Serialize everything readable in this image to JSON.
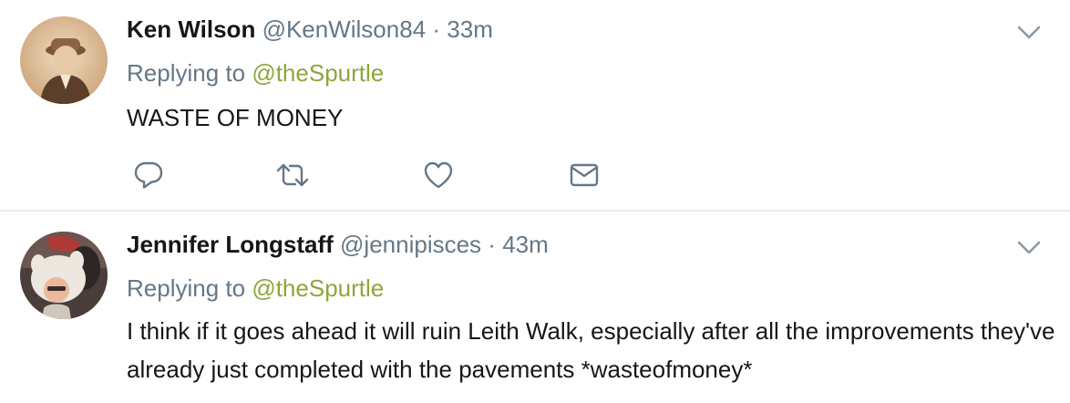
{
  "tweets": [
    {
      "fullname": "Ken Wilson",
      "handle": "@KenWilson84",
      "separator": "·",
      "time": "33m",
      "replying_label": "Replying to",
      "replying_to": "@theSpurtle",
      "text": "WASTE OF MONEY",
      "actions": [
        "reply-icon",
        "retweet-icon",
        "like-icon",
        "direct-message-icon"
      ]
    },
    {
      "fullname": "Jennifer Longstaff",
      "handle": "@jennipisces",
      "separator": "·",
      "time": "43m",
      "replying_label": "Replying to",
      "replying_to": "@theSpurtle",
      "text": "I think if it goes ahead it will ruin Leith Walk, especially after all the improvements they've already just completed with the pavements *wasteofmoney*"
    }
  ],
  "colors": {
    "text": "#14171a",
    "secondary": "#657786",
    "mention": "#8da63a",
    "divider": "#e6ecf0"
  }
}
